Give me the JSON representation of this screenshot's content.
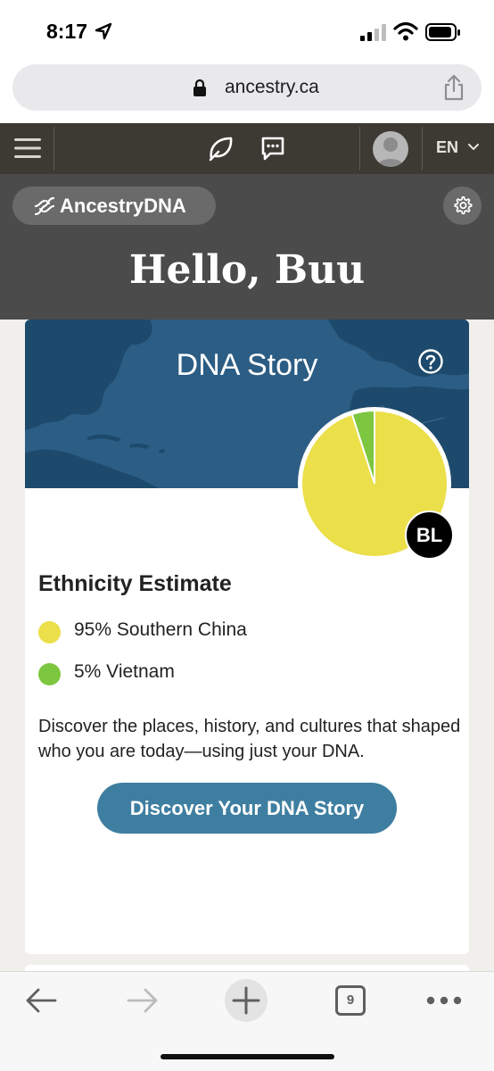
{
  "status_bar": {
    "time": "8:17"
  },
  "url_bar": {
    "url": "ancestry.ca"
  },
  "site_nav": {
    "language": "EN"
  },
  "header": {
    "brand": "AncestryDNA",
    "greeting": "Hello, Buu"
  },
  "dna_story": {
    "title": "DNA Story",
    "badge_initials": "BL",
    "heading": "Ethnicity Estimate",
    "regions": [
      {
        "label": "95% Southern China",
        "percent": 95,
        "color": "#ebdf4a"
      },
      {
        "label": "5% Vietnam",
        "percent": 5,
        "color": "#7dc63f"
      }
    ],
    "description": "Discover the places, history, and cultures that shaped who you are today—using just your DNA.",
    "cta_label": "Discover Your DNA Story"
  },
  "toolbar": {
    "tab_count": "9"
  },
  "colors": {
    "nav_bg": "#3d3933",
    "header_bg": "#4b4b4b",
    "map_ocean": "#2c5d84",
    "cta": "#3e7ea0"
  }
}
